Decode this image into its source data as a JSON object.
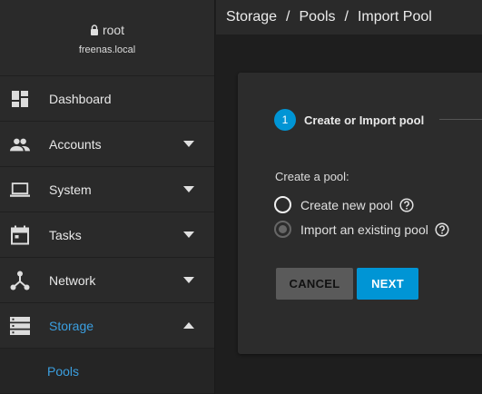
{
  "user": {
    "name": "root",
    "host": "freenas.local"
  },
  "nav": [
    {
      "label": "Dashboard",
      "icon": "dashboard-icon",
      "arrow": ""
    },
    {
      "label": "Accounts",
      "icon": "people-icon",
      "arrow": "down"
    },
    {
      "label": "System",
      "icon": "laptop-icon",
      "arrow": "down"
    },
    {
      "label": "Tasks",
      "icon": "calendar-icon",
      "arrow": "down"
    },
    {
      "label": "Network",
      "icon": "network-icon",
      "arrow": "down"
    },
    {
      "label": "Storage",
      "icon": "storage-icon",
      "arrow": "up",
      "active": true
    }
  ],
  "subnav": {
    "pools_label": "Pools"
  },
  "breadcrumb": {
    "items": [
      "Storage",
      "Pools",
      "Import Pool"
    ],
    "separator": "/"
  },
  "wizard": {
    "step_number": "1",
    "step_label": "Create or Import pool",
    "section_label": "Create a pool:",
    "options": [
      {
        "label": "Create new pool",
        "selected": false
      },
      {
        "label": "Import an existing pool",
        "selected": true,
        "disabled": true
      }
    ],
    "cancel_label": "CANCEL",
    "next_label": "NEXT"
  },
  "colors": {
    "accent": "#0095d5",
    "link": "#3b9fe0",
    "sidebar_bg": "#2a2a2a",
    "page_bg": "#1e1e1e",
    "card_bg": "#2c2c2c"
  }
}
